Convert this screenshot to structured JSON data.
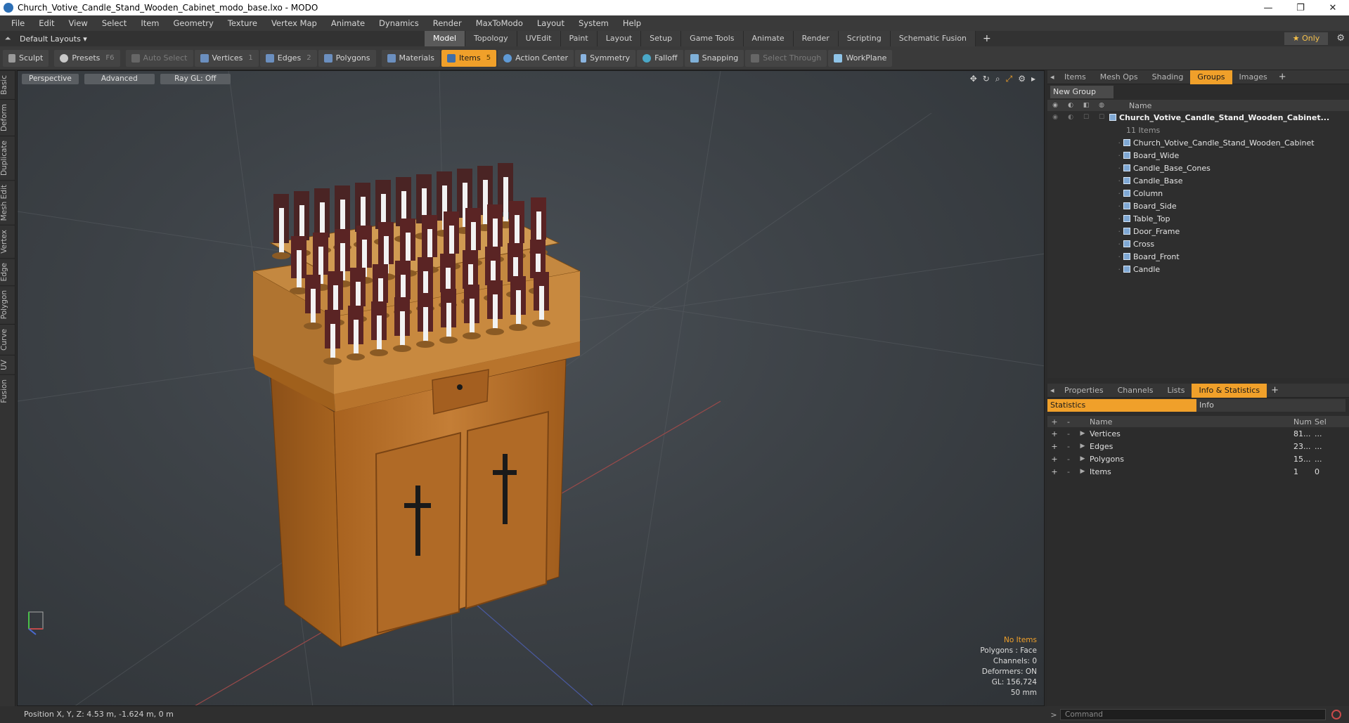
{
  "window": {
    "title": "Church_Votive_Candle_Stand_Wooden_Cabinet_modo_base.lxo - MODO",
    "minimize": "—",
    "maximize": "❐",
    "close": "✕"
  },
  "menu": [
    "File",
    "Edit",
    "View",
    "Select",
    "Item",
    "Geometry",
    "Texture",
    "Vertex Map",
    "Animate",
    "Dynamics",
    "Render",
    "MaxToModo",
    "Layout",
    "System",
    "Help"
  ],
  "layoutbar": {
    "layout_label": "Default Layouts ▾",
    "tabs": [
      "Model",
      "Topology",
      "UVEdit",
      "Paint",
      "Layout",
      "Setup",
      "Game Tools",
      "Animate",
      "Render",
      "Scripting",
      "Schematic Fusion"
    ],
    "active_tab": "Model",
    "add": "+",
    "only": "★ Only"
  },
  "toolbar": {
    "sculpt": "Sculpt",
    "presets": "Presets",
    "presets_key": "F6",
    "auto_select": "Auto Select",
    "vertices": "Vertices",
    "vertices_key": "1",
    "edges": "Edges",
    "edges_key": "2",
    "polygons": "Polygons",
    "materials": "Materials",
    "items": "Items",
    "items_key": "5",
    "action_center": "Action Center",
    "symmetry": "Symmetry",
    "falloff": "Falloff",
    "snapping": "Snapping",
    "select_through": "Select Through",
    "workplane": "WorkPlane"
  },
  "lefttabs": [
    "Basic",
    "Deform",
    "Duplicate",
    "Mesh Edit",
    "Vertex",
    "Edge",
    "Polygon",
    "Curve",
    "UV",
    "Fusion"
  ],
  "viewport": {
    "view": "Perspective",
    "shading": "Advanced",
    "raygl": "Ray GL: Off",
    "stats": {
      "selection": "No Items",
      "polygons": "Polygons : Face",
      "channels": "Channels: 0",
      "deformers": "Deformers: ON",
      "gl": "GL: 156,724",
      "size": "50 mm"
    }
  },
  "rightpanel": {
    "top_tabs": [
      "Items",
      "Mesh Ops",
      "Shading",
      "Groups",
      "Images"
    ],
    "top_active": "Groups",
    "new_group": "New Group",
    "name_header": "Name",
    "root": "Church_Votive_Candle_Stand_Wooden_Cabinet...",
    "root_count": "11 Items",
    "children": [
      "Church_Votive_Candle_Stand_Wooden_Cabinet",
      "Board_Wide",
      "Candle_Base_Cones",
      "Candle_Base",
      "Column",
      "Board_Side",
      "Table_Top",
      "Door_Frame",
      "Cross",
      "Board_Front",
      "Candle"
    ],
    "bottom_tabs": [
      "Properties",
      "Channels",
      "Lists",
      "Info & Statistics"
    ],
    "bottom_active": "Info & Statistics",
    "stats_tab": "Statistics",
    "info_tab": "Info",
    "stats_header": {
      "name": "Name",
      "num": "Num",
      "sel": "Sel"
    },
    "stats_rows": [
      {
        "name": "Vertices",
        "num": "81...",
        "sel": "..."
      },
      {
        "name": "Edges",
        "num": "23...",
        "sel": "..."
      },
      {
        "name": "Polygons",
        "num": "15...",
        "sel": "..."
      },
      {
        "name": "Items",
        "num": "1",
        "sel": "0"
      }
    ]
  },
  "statusbar": {
    "position": "Position X, Y, Z:   4.53 m, -1.624 m, 0 m"
  },
  "command": {
    "placeholder": "Command"
  },
  "colors": {
    "accent": "#f0a02a",
    "wood": "#b8702a",
    "candle": "#f2f2f2",
    "holder": "#4a2424"
  }
}
